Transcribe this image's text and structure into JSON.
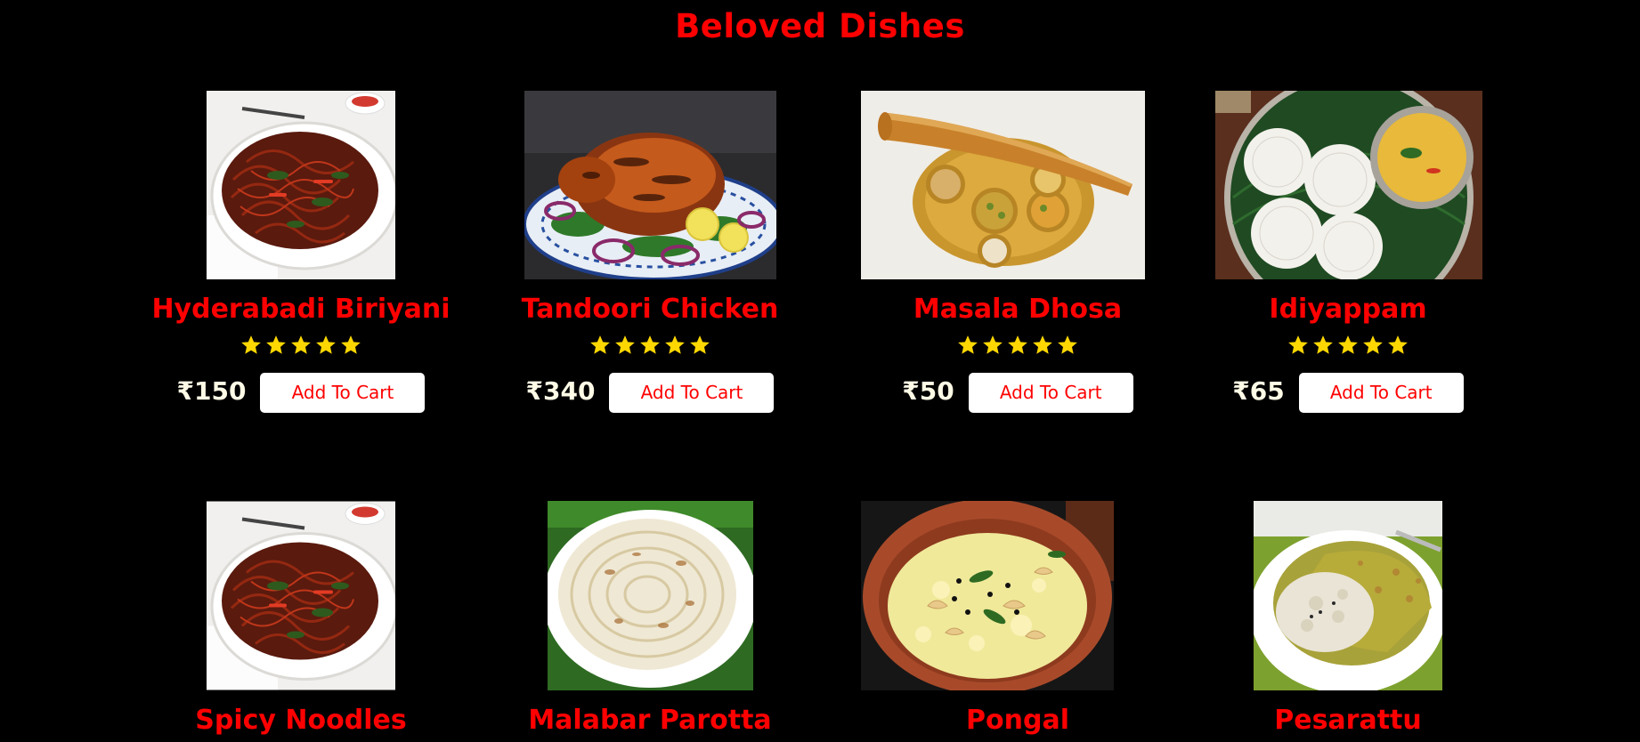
{
  "section": {
    "title": "Beloved Dishes"
  },
  "dishes": [
    {
      "name": "Hyderabadi Biriyani",
      "price": "₹150",
      "button": "Add To Cart",
      "rating": 5,
      "image": "spicy-noodles-plate"
    },
    {
      "name": "Tandoori Chicken",
      "price": "₹340",
      "button": "Add To Cart",
      "rating": 5,
      "image": "tandoori-chicken-plate"
    },
    {
      "name": "Masala Dhosa",
      "price": "₹50",
      "button": "Add To Cart",
      "rating": 5,
      "image": "masala-dosa-thali"
    },
    {
      "name": "Idiyappam",
      "price": "₹65",
      "button": "Add To Cart",
      "rating": 5,
      "image": "idiyappam-banana-leaf"
    },
    {
      "name": "Spicy Noodles",
      "image": "spicy-noodles-plate"
    },
    {
      "name": "Malabar Parotta",
      "image": "malabar-parotta"
    },
    {
      "name": "Pongal",
      "image": "pongal-bowl"
    },
    {
      "name": "Pesarattu",
      "image": "pesarattu-plate"
    }
  ],
  "colors": {
    "background": "#000000",
    "title": "#ff0000",
    "dish_name": "#ff0000",
    "star": "#ffd700",
    "price": "#fffbe6",
    "button_bg": "#ffffff",
    "button_text": "#ff0000"
  },
  "icons": {
    "rating": "star-icon"
  }
}
